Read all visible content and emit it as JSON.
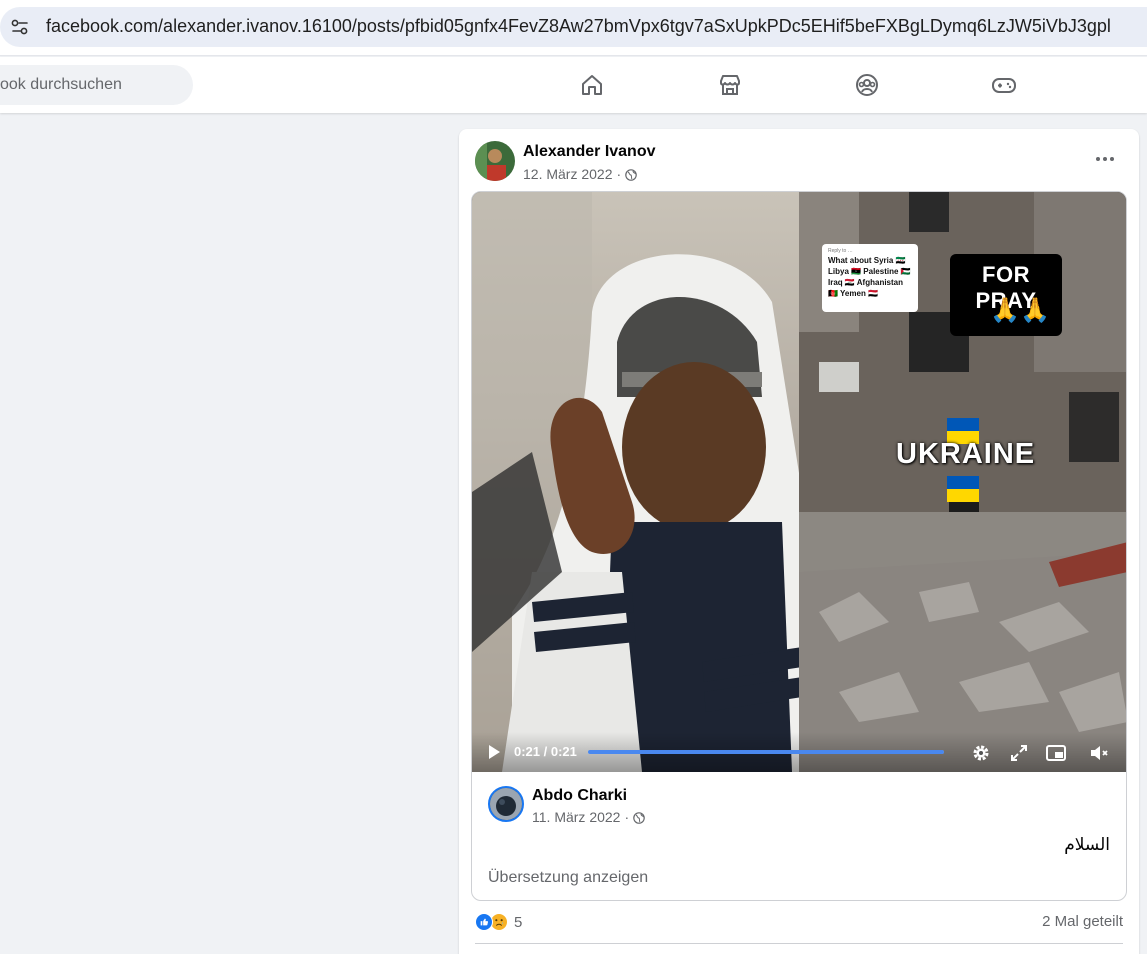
{
  "browser": {
    "url": "facebook.com/alexander.ivanov.16100/posts/pfbid05gnfx4FevZ8Aw27bmVpx6tgv7aSxUpkPDc5EHif5beFXBgLDymq6LzJW5iVbJ3gpl"
  },
  "nav": {
    "search_placeholder": "ook durchsuchen",
    "icons": [
      "home-icon",
      "marketplace-icon",
      "groups-icon",
      "gaming-icon"
    ]
  },
  "post": {
    "author": "Alexander Ivanov",
    "date": "12. März 2022",
    "date_separator": "·",
    "video": {
      "caption_card_small": "Reply to …",
      "caption_card_lines": [
        "What about Syria 🇸🇾",
        "Libya 🇱🇾 Palestine 🇵🇸",
        "Iraq 🇮🇶 Afghanistan",
        "🇦🇫 Yemen 🇾🇪"
      ],
      "for_pray": "FOR PRAY",
      "pray_hands": "🙏🙏",
      "ukraine": "UKRAINE",
      "time": "0:21 / 0:21",
      "progress": 1.0
    },
    "shared": {
      "author": "Abdo Charki",
      "date": "11. März 2022",
      "date_separator": "·",
      "text": "السلام",
      "translate_label": "Übersetzung anzeigen"
    },
    "reactions": {
      "count": "5",
      "types": [
        "like",
        "sad"
      ]
    },
    "shares": "2 Mal geteilt"
  },
  "colors": {
    "accent": "#1877f2",
    "progress": "#4a88ef",
    "secondary_text": "#65676b"
  }
}
